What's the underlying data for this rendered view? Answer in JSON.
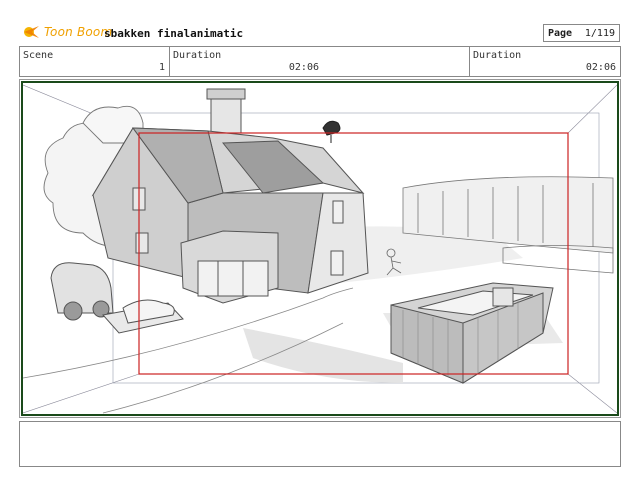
{
  "header": {
    "logo_text": "Toon Boom",
    "project_title": "sbakken finalanimatic",
    "page_label": "Page",
    "page_value": "1/119"
  },
  "info": {
    "scene_label": "Scene",
    "scene_value": "1",
    "duration1_label": "Duration",
    "duration1_value": "02:06",
    "duration2_label": "Duration",
    "duration2_value": "02:06"
  },
  "colors": {
    "logo": "#f0a000",
    "frame_border": "#1a4a1a",
    "camera_box": "#cc2222"
  },
  "notes": {
    "text": ""
  }
}
